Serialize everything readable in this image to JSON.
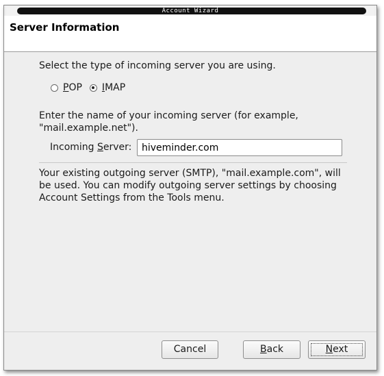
{
  "window": {
    "title": "Account Wizard"
  },
  "header": {
    "title": "Server Information"
  },
  "server_type": {
    "prompt": "Select the type of incoming server you are using.",
    "options": [
      {
        "label": "POP",
        "selected": false
      },
      {
        "label": "IMAP",
        "selected": true
      }
    ]
  },
  "incoming": {
    "prompt_line1": "Enter the name of your incoming server (for example,",
    "prompt_line2": "\"mail.example.net\").",
    "label": "Incoming Server:",
    "value": "hiveminder.com"
  },
  "outgoing": {
    "line1": "Your existing outgoing server (SMTP), \"mail.example.com\", will",
    "line2": "be used. You can modify outgoing server settings by choosing",
    "line3": "Account Settings from the Tools menu."
  },
  "buttons": {
    "cancel": "Cancel",
    "back": "Back",
    "next": "Next"
  }
}
